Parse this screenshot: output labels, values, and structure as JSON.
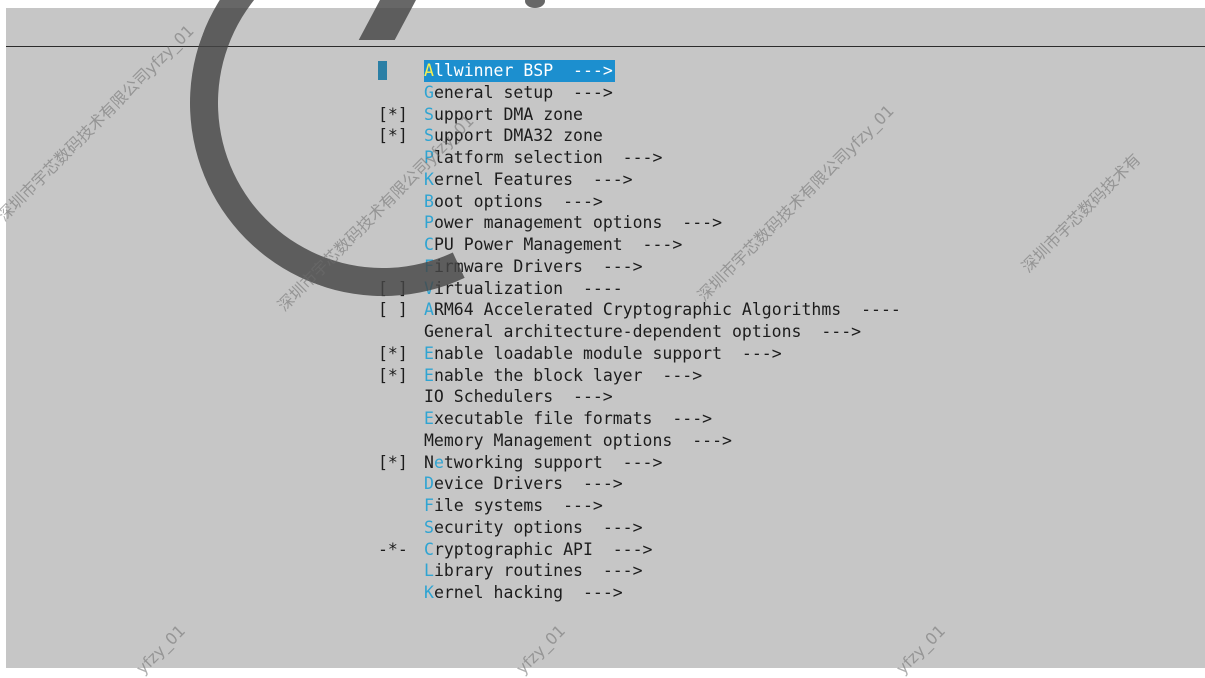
{
  "menu": {
    "items": [
      {
        "marker": "",
        "hot": "A",
        "rest": "llwinner BSP  --->",
        "selected": true
      },
      {
        "marker": "",
        "hot": "G",
        "rest": "eneral setup  --->"
      },
      {
        "marker": "[*]",
        "hot": "S",
        "rest": "upport DMA zone"
      },
      {
        "marker": "[*]",
        "hot": "S",
        "rest": "upport DMA32 zone"
      },
      {
        "marker": "",
        "hot": "P",
        "rest": "latform selection  --->"
      },
      {
        "marker": "",
        "hot": "K",
        "rest": "ernel Features  --->"
      },
      {
        "marker": "",
        "hot": "B",
        "rest": "oot options  --->"
      },
      {
        "marker": "",
        "hot": "P",
        "rest": "ower management options  --->"
      },
      {
        "marker": "",
        "hot": "C",
        "rest": "PU Power Management  --->"
      },
      {
        "marker": "",
        "hot": "F",
        "rest": "irmware Drivers  --->"
      },
      {
        "marker": "[ ]",
        "hot": "V",
        "rest": "irtualization  ----"
      },
      {
        "marker": "[ ]",
        "hot": "A",
        "rest": "RM64 Accelerated Cryptographic Algorithms  ----"
      },
      {
        "marker": "",
        "hot": "",
        "rest": "General architecture-dependent options  --->"
      },
      {
        "marker": "[*]",
        "hot": "E",
        "rest": "nable loadable module support  --->"
      },
      {
        "marker": "[*]",
        "hot": "E",
        "rest": "nable the block layer  --->"
      },
      {
        "marker": "",
        "hot": "",
        "rest": "IO Schedulers  --->"
      },
      {
        "marker": "",
        "hot": "E",
        "rest": "xecutable file formats  --->"
      },
      {
        "marker": "",
        "hot": "",
        "rest": "Memory Management options  --->"
      },
      {
        "marker": "[*]",
        "hot": "",
        "pre": "N",
        "hotmid": "e",
        "rest": "tworking support  --->"
      },
      {
        "marker": "",
        "hot": "D",
        "rest": "evice Drivers  --->"
      },
      {
        "marker": "",
        "hot": "F",
        "rest": "ile systems  --->"
      },
      {
        "marker": "",
        "hot": "S",
        "rest": "ecurity options  --->"
      },
      {
        "marker": "-*-",
        "hot": "C",
        "rest": "ryptographic API  --->"
      },
      {
        "marker": "",
        "hot": "L",
        "rest": "ibrary routines  --->"
      },
      {
        "marker": "",
        "hot": "K",
        "rest": "ernel hacking  --->"
      }
    ]
  },
  "watermarks": {
    "company": "深圳市宇芯数码技术有限公司yfzy_01",
    "company_b": "深圳市宇芯数码技术有",
    "tag": "yfzy_01"
  },
  "colors": {
    "background": "#c6c6c6",
    "hotkey": "#2fa4d2",
    "selected_bg": "#1c8fcf",
    "selected_hotkey": "#f6f050"
  }
}
